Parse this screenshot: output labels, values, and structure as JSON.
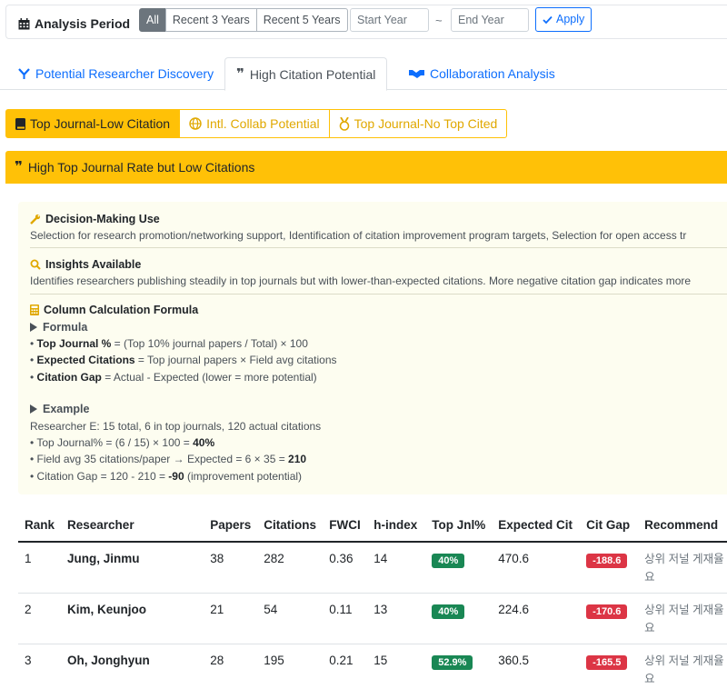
{
  "period": {
    "title": "Analysis Period",
    "buttons": [
      "All",
      "Recent 3 Years",
      "Recent 5 Years"
    ],
    "active_button": "All",
    "start_placeholder": "Start Year",
    "end_placeholder": "End Year",
    "separator": "~",
    "apply_label": "Apply"
  },
  "main_tabs": [
    {
      "label": "Potential Researcher Discovery",
      "icon": "funnel-icon"
    },
    {
      "label": "High Citation Potential",
      "icon": "quote-icon",
      "active": true
    },
    {
      "label": "Collaboration Analysis",
      "icon": "handshake-icon"
    }
  ],
  "sub_tabs": [
    {
      "label": "Top Journal-Low Citation",
      "icon": "book-icon",
      "active": true
    },
    {
      "label": "Intl. Collab Potential",
      "icon": "globe-icon"
    },
    {
      "label": "Top Journal-No Top Cited",
      "icon": "medal-icon"
    }
  ],
  "card": {
    "title": "High Top Journal Rate but Low Citations"
  },
  "info": {
    "decision_title": "Decision-Making Use",
    "decision_text": "Selection for research promotion/networking support, Identification of citation improvement program targets, Selection for open access tr",
    "insights_title": "Insights Available",
    "insights_text": "Identifies researchers publishing steadily in top journals but with lower-than-expected citations. More negative citation gap indicates more",
    "formula_title": "Column Calculation Formula",
    "formula_head": "Formula",
    "formulas": [
      {
        "term": "Top Journal %",
        "def": " = (Top 10% journal papers / Total) × 100"
      },
      {
        "term": "Expected Citations",
        "def": " = Top journal papers × Field avg citations"
      },
      {
        "term": "Citation Gap",
        "def": " = Actual - Expected (lower = more potential)"
      }
    ],
    "example_head": "Example",
    "example_intro": "Researcher E: 15 total, 6 in top journals, 120 actual citations",
    "example_lines": [
      {
        "pre": "• Top Journal% = (6 / 15) × 100 = ",
        "bold": "40%",
        "post": ""
      },
      {
        "pre": "• Field avg 35 citations/paper → Expected = 6 × 35 = ",
        "bold": "210",
        "post": ""
      },
      {
        "pre": "• Citation Gap = 120 - 210 = ",
        "bold": "-90",
        "post": " (improvement potential)"
      }
    ]
  },
  "table": {
    "headers": [
      "Rank",
      "Researcher",
      "Papers",
      "Citations",
      "FWCI",
      "h-index",
      "Top Jnl%",
      "Expected Cit",
      "Cit Gap",
      "Recommend"
    ],
    "rows": [
      {
        "rank": "1",
        "name": "Jung, Jinmu",
        "papers": "38",
        "citations": "282",
        "fwci": "0.36",
        "h": "14",
        "top": "40%",
        "expected": "470.6",
        "gap": "-188.6",
        "rec": "상위 저널 게재율 요"
      },
      {
        "rank": "2",
        "name": "Kim, Keunjoo",
        "papers": "21",
        "citations": "54",
        "fwci": "0.11",
        "h": "13",
        "top": "40%",
        "expected": "224.6",
        "gap": "-170.6",
        "rec": "상위 저널 게재율 요"
      },
      {
        "rank": "3",
        "name": "Oh, Jonghyun",
        "papers": "28",
        "citations": "195",
        "fwci": "0.21",
        "h": "15",
        "top": "52.9%",
        "expected": "360.5",
        "gap": "-165.5",
        "rec": "상위 저널 게재율 요"
      }
    ]
  },
  "colors": {
    "accent": "#0d6efd",
    "warning": "#ffc107",
    "success": "#198754",
    "danger": "#dc3545"
  }
}
